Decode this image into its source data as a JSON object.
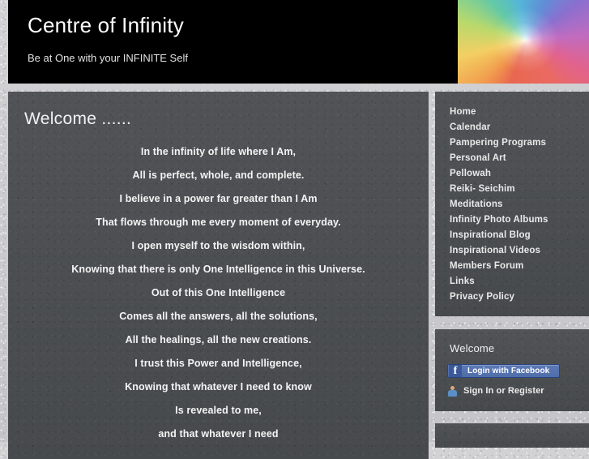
{
  "header": {
    "title": "Centre of Infinity",
    "tagline": "Be at One with your INFINITE Self",
    "banner_icon": "rainbow-spiral-image",
    "background_color": "#000000"
  },
  "main": {
    "heading": "Welcome ......",
    "poem_lines": [
      "In the infinity of life where I Am,",
      "All is perfect, whole, and complete.",
      "I believe in a power far greater than I Am",
      "That flows through me every moment of everyday.",
      "I open myself to the wisdom within,",
      "Knowing that there is only One Intelligence in this Universe.",
      "Out of this One Intelligence",
      "Comes all the answers, all the solutions,",
      "All the healings, all the new creations.",
      "I trust this Power and Intelligence,",
      "Knowing that whatever I need to know",
      "Is revealed to me,",
      "and that whatever I need"
    ]
  },
  "sidebar": {
    "nav_items": [
      {
        "label": "Home"
      },
      {
        "label": "Calendar"
      },
      {
        "label": "Pampering Programs"
      },
      {
        "label": "Personal Art"
      },
      {
        "label": "Pellowah"
      },
      {
        "label": "Reiki- Seichim"
      },
      {
        "label": "Meditations"
      },
      {
        "label": "Infinity Photo Albums"
      },
      {
        "label": "Inspirational Blog"
      },
      {
        "label": "Inspirational Videos"
      },
      {
        "label": "Members Forum"
      },
      {
        "label": "Links"
      },
      {
        "label": "Privacy Policy"
      }
    ],
    "widget": {
      "title": "Welcome",
      "facebook_button_label": "Login with Facebook",
      "facebook_glyph": "f",
      "facebook_button_color": "#3b5998",
      "signin_label": "Sign In or Register",
      "signin_icon": "person-icon"
    }
  },
  "theme": {
    "panel_color": "#4b4d50",
    "page_background": "#c9c9cc",
    "text_color": "#f2f2f2"
  }
}
